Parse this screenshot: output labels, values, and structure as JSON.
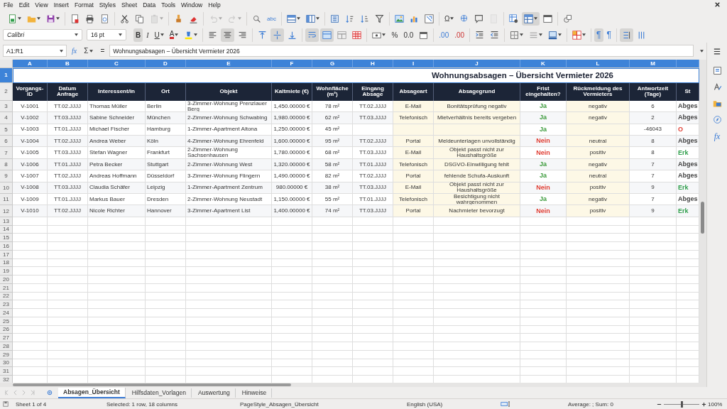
{
  "menu": [
    "File",
    "Edit",
    "View",
    "Insert",
    "Format",
    "Styles",
    "Sheet",
    "Data",
    "Tools",
    "Window",
    "Help"
  ],
  "toolbar_1": [
    [
      {
        "kind": "new",
        "dropdown": true,
        "pressed": false,
        "disabled": false
      },
      {
        "kind": "open",
        "dropdown": true,
        "pressed": false,
        "disabled": false
      },
      {
        "kind": "save",
        "dropdown": true,
        "pressed": false,
        "disabled": false
      }
    ],
    [
      {
        "kind": "pdf",
        "dropdown": false,
        "pressed": false,
        "disabled": false
      },
      {
        "kind": "print",
        "dropdown": false,
        "pressed": false,
        "disabled": false
      },
      {
        "kind": "preview",
        "dropdown": false,
        "pressed": false,
        "disabled": false
      }
    ],
    [
      {
        "kind": "cut",
        "dropdown": false,
        "pressed": false,
        "disabled": false
      },
      {
        "kind": "copy",
        "dropdown": false,
        "pressed": false,
        "disabled": false
      },
      {
        "kind": "paste",
        "dropdown": true,
        "pressed": false,
        "disabled": true
      }
    ],
    [
      {
        "kind": "clone",
        "dropdown": false,
        "pressed": false,
        "disabled": false
      },
      {
        "kind": "clearformat",
        "dropdown": false,
        "pressed": false,
        "disabled": false
      }
    ],
    [
      {
        "kind": "undo",
        "dropdown": true,
        "pressed": false,
        "disabled": true
      },
      {
        "kind": "redo",
        "dropdown": true,
        "pressed": false,
        "disabled": true
      }
    ],
    [
      {
        "kind": "find",
        "dropdown": false,
        "pressed": false,
        "disabled": false
      },
      {
        "kind": "spelling",
        "label": "abc",
        "dropdown": false,
        "pressed": false,
        "disabled": false
      }
    ],
    [
      {
        "kind": "row",
        "dropdown": true,
        "pressed": false,
        "disabled": false
      },
      {
        "kind": "column",
        "dropdown": true,
        "pressed": false,
        "disabled": false
      }
    ],
    [
      {
        "kind": "sort",
        "dropdown": false,
        "pressed": false,
        "disabled": false
      },
      {
        "kind": "sortasc",
        "dropdown": false,
        "pressed": false,
        "disabled": false
      },
      {
        "kind": "sortdesc",
        "dropdown": false,
        "pressed": false,
        "disabled": false
      },
      {
        "kind": "filter",
        "dropdown": false,
        "pressed": false,
        "disabled": false
      }
    ],
    [
      {
        "kind": "image",
        "dropdown": false,
        "pressed": false,
        "disabled": false
      },
      {
        "kind": "chart",
        "dropdown": false,
        "pressed": false,
        "disabled": false
      },
      {
        "kind": "pivot",
        "dropdown": false,
        "pressed": false,
        "disabled": false
      }
    ],
    [
      {
        "kind": "special",
        "label": "Ω",
        "dropdown": true,
        "pressed": false,
        "disabled": false
      },
      {
        "kind": "hyperlink",
        "dropdown": false,
        "pressed": false,
        "disabled": false
      },
      {
        "kind": "comment",
        "dropdown": false,
        "pressed": false,
        "disabled": false
      },
      {
        "kind": "headerfooter",
        "dropdown": false,
        "pressed": false,
        "disabled": true
      }
    ],
    [
      {
        "kind": "printarea",
        "dropdown": false,
        "pressed": false,
        "disabled": false
      },
      {
        "kind": "freeze",
        "dropdown": true,
        "pressed": true,
        "disabled": false
      },
      {
        "kind": "split",
        "dropdown": false,
        "pressed": false,
        "disabled": false
      }
    ],
    [
      {
        "kind": "shapes",
        "dropdown": false,
        "pressed": false,
        "disabled": false
      }
    ]
  ],
  "font_box": {
    "value": "Calibri"
  },
  "size_box": {
    "value": "16 pt"
  },
  "toolbar_2": [
    [
      {
        "kind": "bold",
        "label": "B",
        "dropdown": false,
        "pressed": true,
        "disabled": false
      },
      {
        "kind": "italic",
        "label": "I",
        "dropdown": false,
        "pressed": false,
        "disabled": false
      },
      {
        "kind": "underline",
        "label": "U",
        "dropdown": true,
        "pressed": false,
        "disabled": false
      },
      {
        "kind": "fontcolor",
        "label": "A",
        "dropdown": true,
        "pressed": false,
        "disabled": false
      },
      {
        "kind": "highlight",
        "dropdown": true,
        "pressed": false,
        "disabled": false
      }
    ],
    [
      {
        "kind": "alignleft",
        "dropdown": false,
        "pressed": false,
        "disabled": false
      },
      {
        "kind": "aligncenter",
        "dropdown": false,
        "pressed": true,
        "disabled": false
      },
      {
        "kind": "alignright",
        "dropdown": false,
        "pressed": false,
        "disabled": false
      }
    ],
    [
      {
        "kind": "aligntop",
        "dropdown": false,
        "pressed": false,
        "disabled": false
      },
      {
        "kind": "alignmiddle",
        "dropdown": false,
        "pressed": true,
        "disabled": false
      },
      {
        "kind": "alignbottom",
        "dropdown": false,
        "pressed": false,
        "disabled": false
      }
    ],
    [
      {
        "kind": "wrap",
        "dropdown": false,
        "pressed": true,
        "disabled": false
      },
      {
        "kind": "merge",
        "dropdown": false,
        "pressed": true,
        "disabled": false
      },
      {
        "kind": "mergeoff",
        "dropdown": false,
        "pressed": false,
        "disabled": false
      },
      {
        "kind": "unmerge",
        "dropdown": false,
        "pressed": false,
        "disabled": false
      }
    ],
    [
      {
        "kind": "currency",
        "dropdown": true,
        "pressed": false,
        "disabled": false
      },
      {
        "kind": "percent",
        "label": "%",
        "dropdown": false,
        "pressed": false,
        "disabled": false
      },
      {
        "kind": "number",
        "label": "0.0",
        "dropdown": false,
        "pressed": false,
        "disabled": false
      },
      {
        "kind": "date",
        "dropdown": false,
        "pressed": false,
        "disabled": false
      }
    ],
    [
      {
        "kind": "adddecimal",
        "label": ".00",
        "dropdown": false,
        "pressed": false,
        "disabled": false
      },
      {
        "kind": "deldecimal",
        "label": ".00",
        "dropdown": false,
        "pressed": false,
        "disabled": false
      }
    ],
    [
      {
        "kind": "indent",
        "dropdown": false,
        "pressed": false,
        "disabled": false
      },
      {
        "kind": "outdent",
        "dropdown": false,
        "pressed": false,
        "disabled": false
      }
    ],
    [
      {
        "kind": "borders",
        "dropdown": true,
        "pressed": false,
        "disabled": false
      },
      {
        "kind": "borderstyle",
        "dropdown": true,
        "pressed": false,
        "disabled": false
      },
      {
        "kind": "bordercolor",
        "dropdown": true,
        "pressed": false,
        "disabled": false
      }
    ],
    [
      {
        "kind": "conditional",
        "dropdown": true,
        "pressed": false,
        "disabled": false
      }
    ],
    [
      {
        "kind": "ltr",
        "label": "¶",
        "dropdown": false,
        "pressed": true,
        "disabled": false
      },
      {
        "kind": "rtl",
        "label": "¶",
        "dropdown": false,
        "pressed": false,
        "disabled": false
      }
    ],
    [
      {
        "kind": "textvertical",
        "dropdown": false,
        "pressed": true,
        "disabled": false
      },
      {
        "kind": "stacked",
        "dropdown": false,
        "pressed": false,
        "disabled": false
      }
    ]
  ],
  "formula_bar": {
    "cell_reference": "A1:R1",
    "wizard_label": "fx",
    "sum_label": "Σ",
    "equals_label": "=",
    "content": "Wohnungsabsagen – Übersicht Vermieter 2026"
  },
  "sidebar": [
    {
      "kind": "properties"
    },
    {
      "kind": "styles"
    },
    {
      "kind": "gallery"
    },
    {
      "kind": "navigator"
    },
    {
      "kind": "functions",
      "label": "fx"
    }
  ],
  "sheet": {
    "columns": [
      {
        "letter": "A",
        "heading": "Vorgangs-ID",
        "selected": true,
        "highlight": false
      },
      {
        "letter": "B",
        "heading": "Datum Anfrage",
        "selected": true,
        "highlight": false
      },
      {
        "letter": "C",
        "heading": "Interessent/in",
        "selected": true,
        "highlight": false
      },
      {
        "letter": "D",
        "heading": "Ort",
        "selected": true,
        "highlight": false
      },
      {
        "letter": "E",
        "heading": "Objekt",
        "selected": true,
        "highlight": false
      },
      {
        "letter": "F",
        "heading": "Kaltmiete (€)",
        "selected": true,
        "highlight": false
      },
      {
        "letter": "G",
        "heading": "Wohnfläche (m²)",
        "selected": true,
        "highlight": false
      },
      {
        "letter": "H",
        "heading": "Eingang Absage",
        "selected": true,
        "highlight": false
      },
      {
        "letter": "I",
        "heading": "Absageart",
        "selected": true,
        "highlight": true
      },
      {
        "letter": "J",
        "heading": "Absagegrund",
        "selected": true,
        "highlight": true
      },
      {
        "letter": "K",
        "heading": "Frist eingehalten?",
        "selected": true,
        "highlight": false
      },
      {
        "letter": "L",
        "heading": "Rückmeldung des Vermieters",
        "selected": true,
        "highlight": true
      },
      {
        "letter": "M",
        "heading": "Antwortzeit (Tage)",
        "selected": true,
        "highlight": false
      },
      {
        "heading": "St",
        "selected": true,
        "highlight": false
      }
    ],
    "title_row": {
      "number": "1",
      "selected": true,
      "title": "Wohnungsabsagen – Übersicht Vermieter 2026"
    },
    "header_row": {
      "number": "2"
    },
    "rows": [
      {
        "number": "3",
        "cells": [
          "V-1001",
          "TT.02.JJJJ",
          "Thomas Müller",
          "Berlin",
          "3-Zimmer-Wohnung Prenzlauer Berg",
          "1,450.00000 €",
          "78 m²",
          "TT.02.JJJJ",
          "E-Mail",
          "Bonitätsprüfung negativ",
          {
            "text": "Ja",
            "color": "#3a9a3a"
          },
          "negativ",
          "6",
          {
            "text": "Abges",
            "color": "#444444"
          }
        ]
      },
      {
        "number": "4",
        "cells": [
          "V-1002",
          "TT.03.JJJJ",
          "Sabine Schneider",
          "München",
          "2-Zimmer-Wohnung Schwabing",
          "1,980.00000 €",
          "62 m²",
          "TT.03.JJJJ",
          "Telefonisch",
          "Mietverhältnis bereits vergeben",
          {
            "text": "Ja",
            "color": "#3a9a3a"
          },
          "negativ",
          "2",
          {
            "text": "Abges",
            "color": "#444444"
          }
        ]
      },
      {
        "number": "5",
        "cells": [
          "V-1003",
          "TT.01.JJJJ",
          "Michael Fischer",
          "Hamburg",
          "1-Zimmer-Apartment Altona",
          "1,250.00000 €",
          "45 m²",
          null,
          null,
          null,
          {
            "text": "Ja",
            "color": "#3a9a3a"
          },
          null,
          "-46043",
          {
            "text": "O",
            "color": "#e03c31"
          }
        ]
      },
      {
        "number": "6",
        "cells": [
          "V-1004",
          "TT.02.JJJJ",
          "Andrea Weber",
          "Köln",
          "4-Zimmer-Wohnung Ehrenfeld",
          "1,600.00000 €",
          "95 m²",
          "TT.02.JJJJ",
          "Portal",
          "Meldeunterlagen unvollständig",
          {
            "text": "Nein",
            "color": "#e03c31"
          },
          "neutral",
          "8",
          {
            "text": "Abges",
            "color": "#444444"
          }
        ]
      },
      {
        "number": "7",
        "cells": [
          "V-1005",
          "TT.03.JJJJ",
          "Stefan Wagner",
          "Frankfurt",
          "2-Zimmer-Wohnung Sachsenhausen",
          "1,780.00000 €",
          "68 m²",
          "TT.03.JJJJ",
          "E-Mail",
          "Objekt passt nicht zur Haushaltsgröße",
          {
            "text": "Nein",
            "color": "#e03c31"
          },
          "positiv",
          "8",
          {
            "text": "Erk",
            "color": "#2e9e4a"
          }
        ]
      },
      {
        "number": "8",
        "cells": [
          "V-1006",
          "TT.01.JJJJ",
          "Petra Becker",
          "Stuttgart",
          "2-Zimmer-Wohnung West",
          "1,320.00000 €",
          "58 m²",
          "TT.01.JJJJ",
          "Telefonisch",
          "DSGVO-Einwilligung fehlt",
          {
            "text": "Ja",
            "color": "#3a9a3a"
          },
          "negativ",
          "7",
          {
            "text": "Abges",
            "color": "#444444"
          }
        ]
      },
      {
        "number": "9",
        "cells": [
          "V-1007",
          "TT.02.JJJJ",
          "Andreas Hoffmann",
          "Düsseldorf",
          "3-Zimmer-Wohnung Flingern",
          "1,490.00000 €",
          "82 m²",
          "TT.02.JJJJ",
          "Portal",
          "fehlende Schufa-Auskunft",
          {
            "text": "Ja",
            "color": "#3a9a3a"
          },
          "neutral",
          "7",
          {
            "text": "Abges",
            "color": "#444444"
          }
        ]
      },
      {
        "number": "10",
        "cells": [
          "V-1008",
          "TT.03.JJJJ",
          "Claudia Schäfer",
          "Leipzig",
          "1-Zimmer-Apartment Zentrum",
          "980.00000 €",
          "38 m²",
          "TT.03.JJJJ",
          "E-Mail",
          "Objekt passt nicht zur Haushaltsgröße",
          {
            "text": "Nein",
            "color": "#e03c31"
          },
          "positiv",
          "9",
          {
            "text": "Erk",
            "color": "#2e9e4a"
          }
        ]
      },
      {
        "number": "11",
        "cells": [
          "V-1009",
          "TT.01.JJJJ",
          "Markus Bauer",
          "Dresden",
          "2-Zimmer-Wohnung Neustadt",
          "1,150.00000 €",
          "55 m²",
          "TT.01.JJJJ",
          "Telefonisch",
          "Besichtigung nicht wahrgenommen",
          {
            "text": "Ja",
            "color": "#3a9a3a"
          },
          "negativ",
          "7",
          {
            "text": "Abges",
            "color": "#444444"
          }
        ]
      },
      {
        "number": "12",
        "cells": [
          "V-1010",
          "TT.02.JJJJ",
          "Nicole Richter",
          "Hannover",
          "3-Zimmer-Apartment List",
          "1,400.00000 €",
          "74 m²",
          "TT.03.JJJJ",
          "Portal",
          "Nachmieter bevorzugt",
          {
            "text": "Nein",
            "color": "#e03c31"
          },
          "positiv",
          "9",
          {
            "text": "Erk",
            "color": "#2e9e4a"
          }
        ]
      }
    ],
    "empty_rows": [
      "13",
      "14",
      "15",
      "16",
      "17",
      "18",
      "19",
      "20",
      "21",
      "22",
      "23",
      "24",
      "25",
      "26",
      "27",
      "28",
      "29",
      "30",
      "31",
      "32"
    ]
  },
  "sheet_tabs": [
    {
      "label": "Absagen_Übersicht",
      "selected": true
    },
    {
      "label": "Hilfsdaten_Vorlagen",
      "selected": false
    },
    {
      "label": "Auswertung",
      "selected": false
    },
    {
      "label": "Hinweise",
      "selected": false
    }
  ],
  "status_bar": {
    "sheet": "Sheet 1 of 4",
    "selection": "Selected: 1 row, 18 columns",
    "page_style": "PageStyle_Absagen_Übersicht",
    "language": "English (USA)",
    "summary": "Average: ; Sum: 0",
    "zoom": {
      "level": 0.5
    },
    "zoom_value": "100%"
  }
}
